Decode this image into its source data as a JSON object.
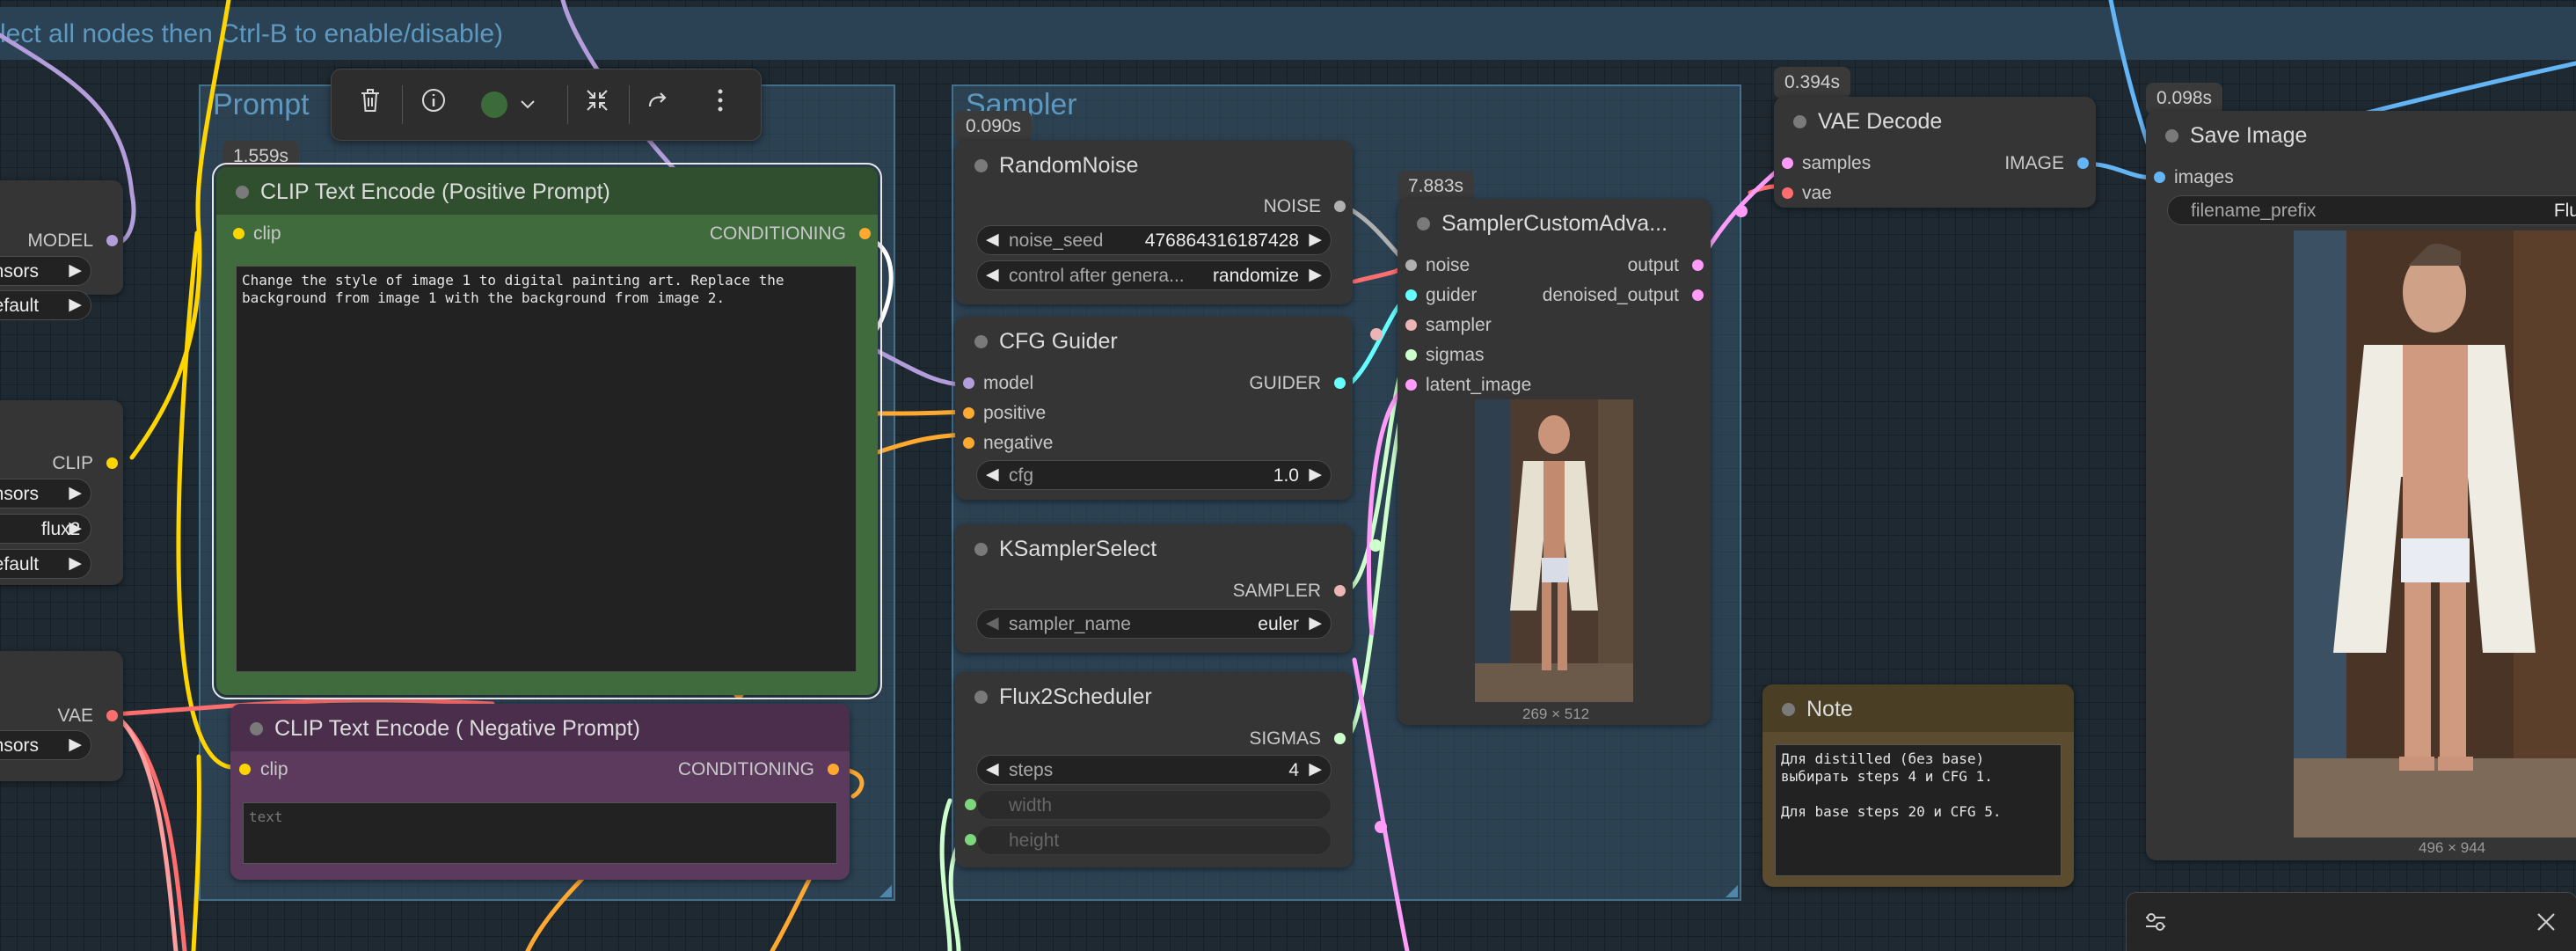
{
  "canvas": {
    "top_hint": "lect all nodes then Ctrl-B to enable/disable)"
  },
  "groups": {
    "prompt": {
      "title": "Prompt"
    },
    "sampler": {
      "title": "Sampler"
    }
  },
  "toolbar": {
    "delete_icon": "trash-icon",
    "info_icon": "info-icon",
    "color": "#3c6b3a",
    "color_icon": "chevron-down-icon",
    "collapse_icon": "collapse-icon",
    "bypass_icon": "redo-arrow-icon",
    "more_icon": "more-vertical-icon"
  },
  "left_nodes": {
    "model_out": "MODEL",
    "w1": "ensors",
    "w2": "default",
    "clip_out": "CLIP",
    "w3": "ensors",
    "w4": "flux2",
    "w5": "default",
    "vae_out": "VAE",
    "w6": "ensors"
  },
  "clip_pos": {
    "time": "1.559s",
    "title": "CLIP Text Encode (Positive Prompt)",
    "input": "clip",
    "output": "CONDITIONING",
    "text": "Change the style of image 1 to digital painting art. Replace the background from image 1 with the background from image 2."
  },
  "clip_neg": {
    "title": "CLIP Text Encode ( Negative Prompt)",
    "input": "clip",
    "output": "CONDITIONING",
    "placeholder": "text"
  },
  "random_noise": {
    "time": "0.090s",
    "title": "RandomNoise",
    "output": "NOISE",
    "noise_seed_label": "noise_seed",
    "noise_seed_value": "476864316187428",
    "control_label": "control after genera...",
    "control_value": "randomize"
  },
  "cfg_guider": {
    "title": "CFG Guider",
    "in_model": "model",
    "in_positive": "positive",
    "in_negative": "negative",
    "output": "GUIDER",
    "cfg_label": "cfg",
    "cfg_value": "1.0"
  },
  "ksampler_select": {
    "title": "KSamplerSelect",
    "output": "SAMPLER",
    "sampler_label": "sampler_name",
    "sampler_value": "euler"
  },
  "flux2_scheduler": {
    "title": "Flux2Scheduler",
    "output": "SIGMAS",
    "steps_label": "steps",
    "steps_value": "4",
    "width_label": "width",
    "height_label": "height"
  },
  "sampler_custom": {
    "time": "7.883s",
    "title": "SamplerCustomAdva...",
    "in_noise": "noise",
    "in_guider": "guider",
    "in_sampler": "sampler",
    "in_sigmas": "sigmas",
    "in_latent": "latent_image",
    "out_output": "output",
    "out_denoised": "denoised_output",
    "preview_dims": "269 × 512"
  },
  "vae_decode": {
    "time": "0.394s",
    "title": "VAE Decode",
    "in_samples": "samples",
    "in_vae": "vae",
    "output": "IMAGE"
  },
  "save_image": {
    "time": "0.098s",
    "title": "Save Image",
    "input": "images",
    "prefix_label": "filename_prefix",
    "prefix_value": "Flu",
    "image_dims": "496 × 944"
  },
  "note": {
    "title": "Note",
    "text": "Для distilled (без base) выбирать steps 4 и CFG 1.\n\nДля base steps 20 и CFG 5."
  },
  "bottom_panel": {
    "settings_icon": "sliders-icon",
    "close_icon": "close-icon"
  },
  "colors": {
    "model": "#b39ddb",
    "clip": "#ffd500",
    "conditioning": "#ffa931",
    "vae": "#ff6e6e",
    "noise": "#b0b0b0",
    "guider": "#66ffff",
    "sampler": "#ecb4b4",
    "sigmas": "#cdffcd",
    "latent": "#ff9cf9",
    "image": "#64b5f6"
  }
}
